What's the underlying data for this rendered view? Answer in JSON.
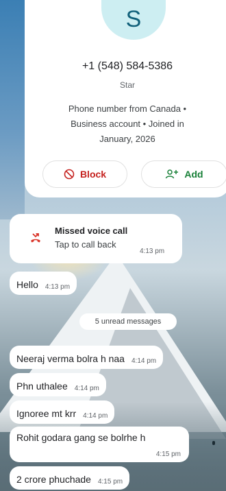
{
  "contact": {
    "avatar_letter": "S",
    "phone": "+1 (548) 584-5386",
    "label": "Star",
    "info_lines": [
      "Phone number from Canada •",
      "Business account • Joined in",
      "January, 2026"
    ],
    "block_label": "Block",
    "add_label": "Add"
  },
  "missed_call": {
    "title": "Missed voice call",
    "subtitle": "Tap to call back",
    "time": "4:13 pm"
  },
  "unread_label": "5 unread messages",
  "messages": [
    {
      "text": "Hello",
      "time": "4:13 pm"
    },
    {
      "text": "Neeraj verma bolra h naa",
      "time": "4:14 pm"
    },
    {
      "text": "Phn uthalee",
      "time": "4:14 pm"
    },
    {
      "text": "Ignoree mt krr",
      "time": "4:14 pm"
    },
    {
      "text": "Rohit godara gang se bolrhe h",
      "time": "4:15 pm"
    },
    {
      "text": "2 crore phuchade",
      "time": "4:15 pm"
    }
  ],
  "colors": {
    "block": "#c5221f",
    "add": "#188038",
    "missed_icon": "#d93025",
    "avatar_bg": "#cdeef2"
  },
  "icons": {
    "block": "block-icon",
    "add": "add-contact-icon",
    "missed_call": "missed-call-icon"
  }
}
